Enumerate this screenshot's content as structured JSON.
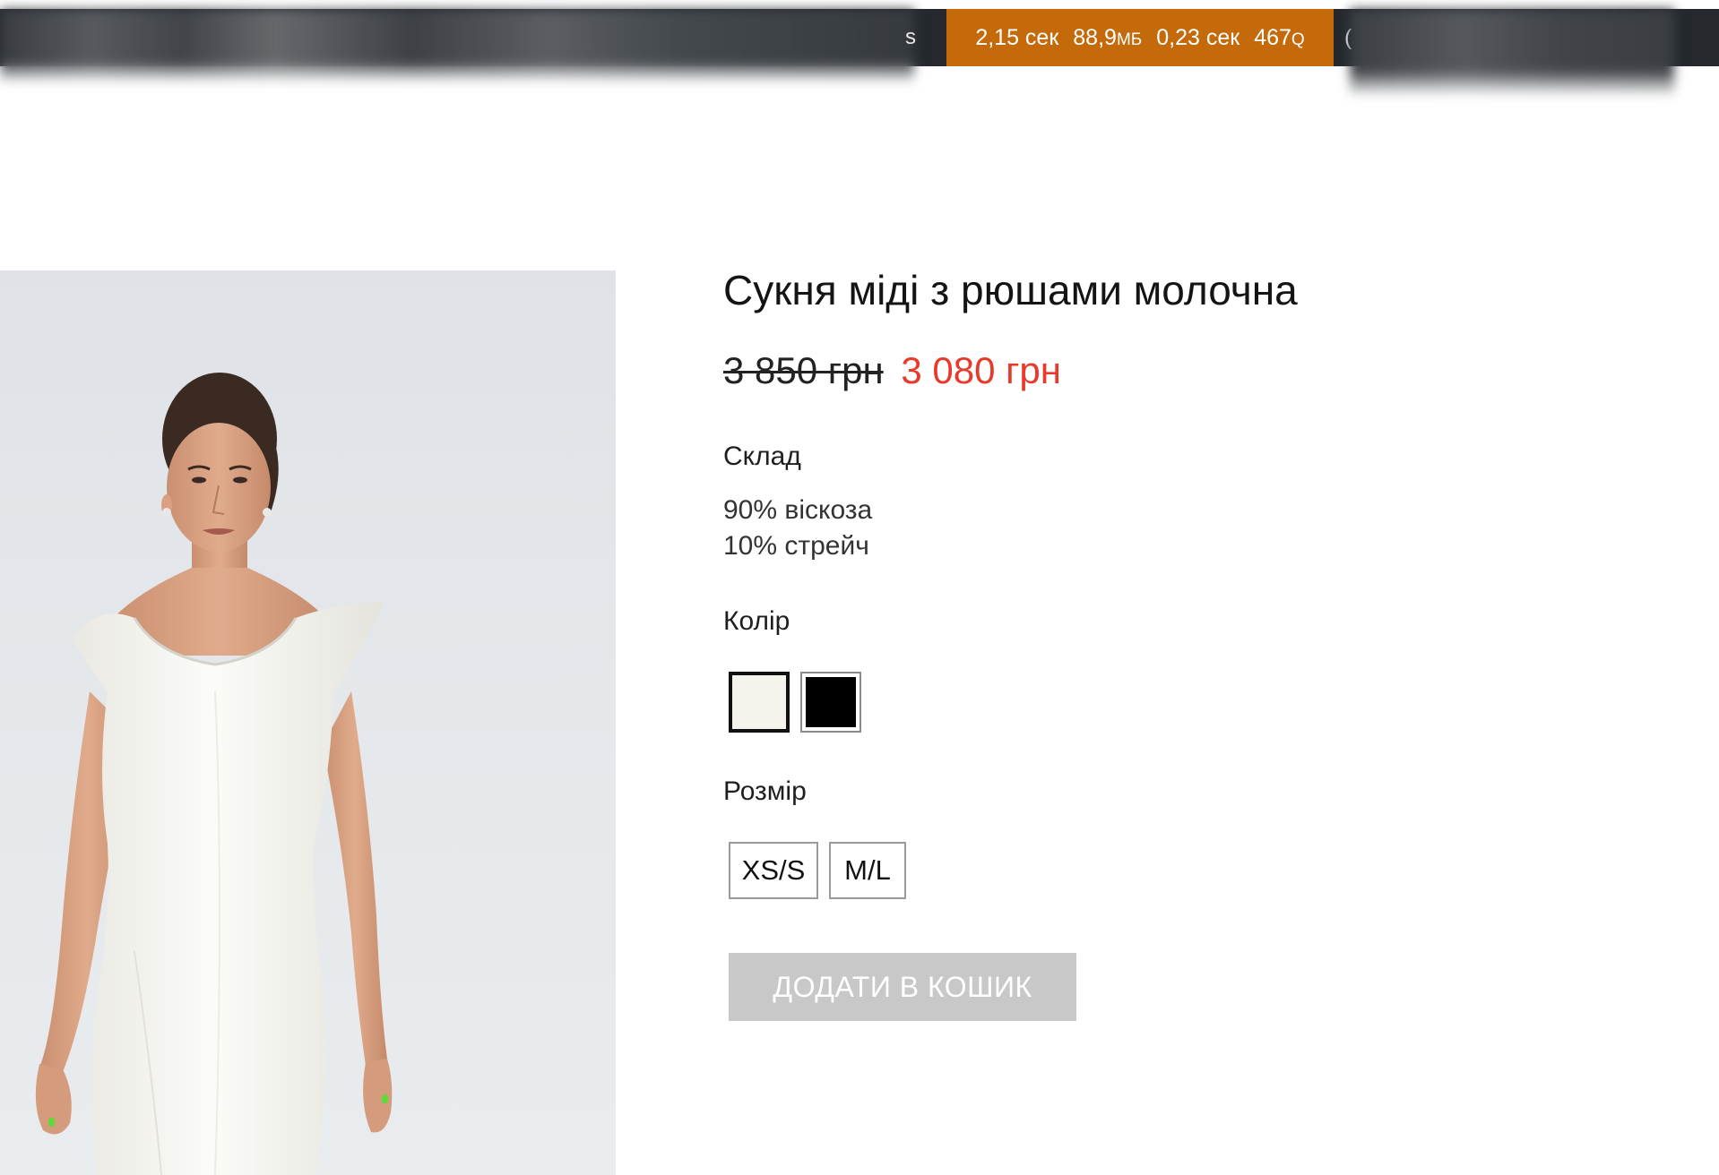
{
  "toolbar": {
    "ms_fragment": "s",
    "stat_time": "2,15 сек",
    "stat_memory_value": "88,9",
    "stat_memory_unit": "МБ",
    "stat_query_time": "0,23 сек",
    "stat_queries_value": "467",
    "stat_queries_unit": "Q",
    "after_fragment": "(",
    "accent_color": "#c46a0a"
  },
  "product": {
    "title": "Сукня міді з рюшами молочна",
    "price_old": "3 850 грн",
    "price_new": "3 080 грн",
    "price_new_color": "#e8392b",
    "composition_label": "Склад",
    "composition": [
      "90% віскоза",
      "10% стрейч"
    ],
    "color_label": "Колір",
    "colors": [
      {
        "name": "milk",
        "hex": "#f5f4ec",
        "selected": true
      },
      {
        "name": "black",
        "hex": "#000000",
        "selected": false
      }
    ],
    "size_label": "Розмір",
    "sizes": [
      "XS/S",
      "M/L"
    ],
    "add_to_cart_label": "ДОДАТИ В КОШИК",
    "image_alt": "product-photo"
  }
}
